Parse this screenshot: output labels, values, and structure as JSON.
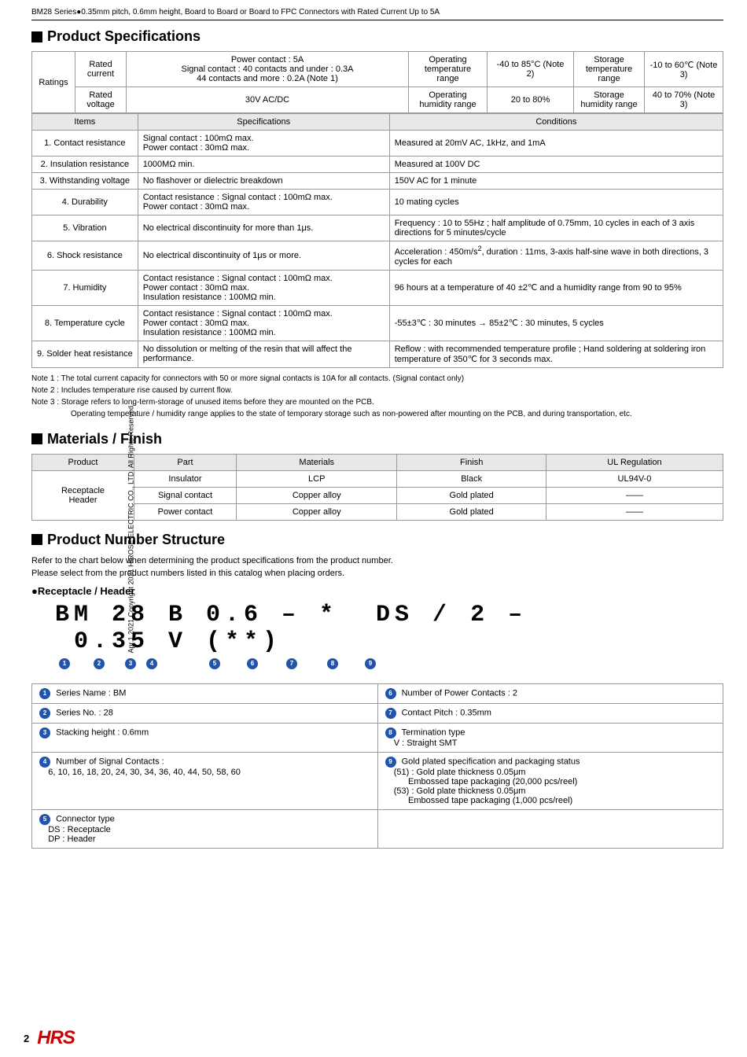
{
  "page": {
    "header": "BM28 Series●0.35mm pitch, 0.6mm height, Board to Board or Board to FPC Connectors with Rated Current Up to 5A",
    "vertical_text": "Apr.1.2021 Copyright 2021 HIROSE ELECTRIC CO., LTD. All Rights Reserved.",
    "page_number": "2"
  },
  "product_specifications": {
    "title": "Product Specifications",
    "ratings": {
      "headers": [
        "",
        "",
        "",
        "Operating temperature range",
        "",
        "Storage temperature range",
        ""
      ],
      "rows": [
        {
          "label": "Ratings",
          "sub": "Rated current",
          "col2": "Power contact : 5A\nSignal contact : 40 contacts and under : 0.3A\n44 contacts and more : 0.2A (Note 1)",
          "col3": "Operating temperature range",
          "col4": "-40 to 85°C (Note 2)",
          "col5": "Storage temperature range",
          "col6": "-10 to 60℃ (Note 3)"
        },
        {
          "sub": "Rated voltage",
          "col2": "30V AC/DC",
          "col3": "Operating humidity range",
          "col4": "20 to 80%",
          "col5": "Storage humidity range",
          "col6": "40 to 70% (Note 3)"
        }
      ]
    },
    "specs": {
      "col_headers": [
        "Items",
        "Specifications",
        "Conditions"
      ],
      "rows": [
        {
          "item": "1. Contact resistance",
          "spec": "Signal contact : 100mΩ max.\nPower contact : 30mΩ max.",
          "condition": "Measured at 20mV AC, 1kHz, and 1mA"
        },
        {
          "item": "2. Insulation resistance",
          "spec": "1000MΩ min.",
          "condition": "Measured at 100V DC"
        },
        {
          "item": "3. Withstanding voltage",
          "spec": "No flashover or dielectric breakdown",
          "condition": "150V AC for 1 minute"
        },
        {
          "item": "4. Durability",
          "spec": "Contact resistance : Signal contact : 100mΩ max.\nPower contact : 30mΩ max.",
          "condition": "10 mating cycles"
        },
        {
          "item": "5. Vibration",
          "spec": "No electrical discontinuity for more than 1μs.",
          "condition": "Frequency : 10 to 55Hz ; half amplitude of 0.75mm, 10 cycles in each of 3 axis directions for 5 minutes/cycle"
        },
        {
          "item": "6. Shock resistance",
          "spec": "No electrical discontinuity of 1μs or more.",
          "condition": "Acceleration : 450m/s², duration : 11ms, 3-axis half-sine wave in both directions, 3 cycles for each"
        },
        {
          "item": "7. Humidity",
          "spec": "Contact resistance : Signal contact : 100mΩ max.\nPower contact : 30mΩ max.\nInsulation resistance : 100MΩ min.",
          "condition": "96 hours at a temperature of 40 ±2℃ and a humidity range from 90 to 95%"
        },
        {
          "item": "8. Temperature cycle",
          "spec": "Contact resistance : Signal contact : 100mΩ max.\nPower contact : 30mΩ max.\nInsulation resistance : 100MΩ min.",
          "condition": "-55±3℃ : 30 minutes → 85±2℃ : 30 minutes, 5 cycles"
        },
        {
          "item": "9. Solder heat resistance",
          "spec": "No dissolution or melting of the resin that will affect the performance.",
          "condition": "Reflow : with recommended temperature profile ; Hand soldering at soldering iron temperature of 350℃ for 3 seconds max."
        }
      ]
    },
    "notes": [
      "Note 1 : The total current capacity for connectors with 50 or more signal contacts is 10A for all contacts. (Signal contact only)",
      "Note 2 : Includes temperature rise caused by current flow.",
      "Note 3 : Storage refers to long-term-storage of unused items before they are mounted on the PCB.",
      "         Operating temperature / humidity range applies to the state of temporary storage such as non-powered after mounting on the PCB, and during transportation, etc."
    ]
  },
  "materials_finish": {
    "title": "Materials / Finish",
    "col_headers": [
      "Product",
      "Part",
      "Materials",
      "Finish",
      "UL Regulation"
    ],
    "rows": [
      {
        "product": "Receptacle\nHeader",
        "part": "Insulator",
        "materials": "LCP",
        "finish": "Black",
        "ul": "UL94V-0"
      },
      {
        "product": "",
        "part": "Signal contact",
        "materials": "Copper alloy",
        "finish": "Gold plated",
        "ul": "——"
      },
      {
        "product": "",
        "part": "Power contact",
        "materials": "Copper alloy",
        "finish": "Gold plated",
        "ul": "——"
      }
    ]
  },
  "product_number_structure": {
    "title": "Product Number Structure",
    "intro_line1": "Refer to the chart below when determining the product specifications from the product number.",
    "intro_line2": "Please select from the product numbers listed in this catalog when placing orders.",
    "bullet_header": "●Receptacle / Header",
    "pn_display": "BM 28 B 0.6 – * DS / 2 – 0.35 V (**)",
    "pn_tokens": [
      "BM",
      "28",
      "B",
      "0.6",
      "–",
      "*",
      "DS",
      "/",
      "2",
      "–",
      "0.35",
      "V",
      "(**)"
    ],
    "circle_indices": [
      "❶",
      "❷",
      "❸",
      "❹",
      "❺",
      "❻",
      "❼",
      "❽",
      "❾"
    ],
    "circle_positions": [
      1,
      2,
      3,
      4,
      5,
      6,
      7,
      8,
      9
    ],
    "descriptions": [
      {
        "num": "❶",
        "label": "Series Name : BM",
        "right_num": "❻",
        "right_label": "Number of Power Contacts : 2"
      },
      {
        "num": "❷",
        "label": "Series No. : 28",
        "right_num": "❼",
        "right_label": "Contact Pitch : 0.35mm"
      },
      {
        "num": "❸",
        "label": "Stacking height : 0.6mm",
        "right_num": "❽",
        "right_label": "Termination type\nV : Straight SMT"
      },
      {
        "num": "❹",
        "label": "Number of Signal Contacts :\n6, 10, 16, 18, 20, 24, 30, 34, 36, 40, 44, 50, 58, 60",
        "right_num": "❾",
        "right_label": "Gold plated specification and packaging status\n(51) : Gold plate thickness 0.05μm\n       Embossed tape packaging (20,000 pcs/reel)\n(53) : Gold plate thickness 0.05μm\n       Embossed tape packaging (1,000 pcs/reel)"
      },
      {
        "num": "❺",
        "label": "Connector type\nDS : Receptacle\nDP : Header",
        "right_num": "",
        "right_label": ""
      }
    ]
  }
}
